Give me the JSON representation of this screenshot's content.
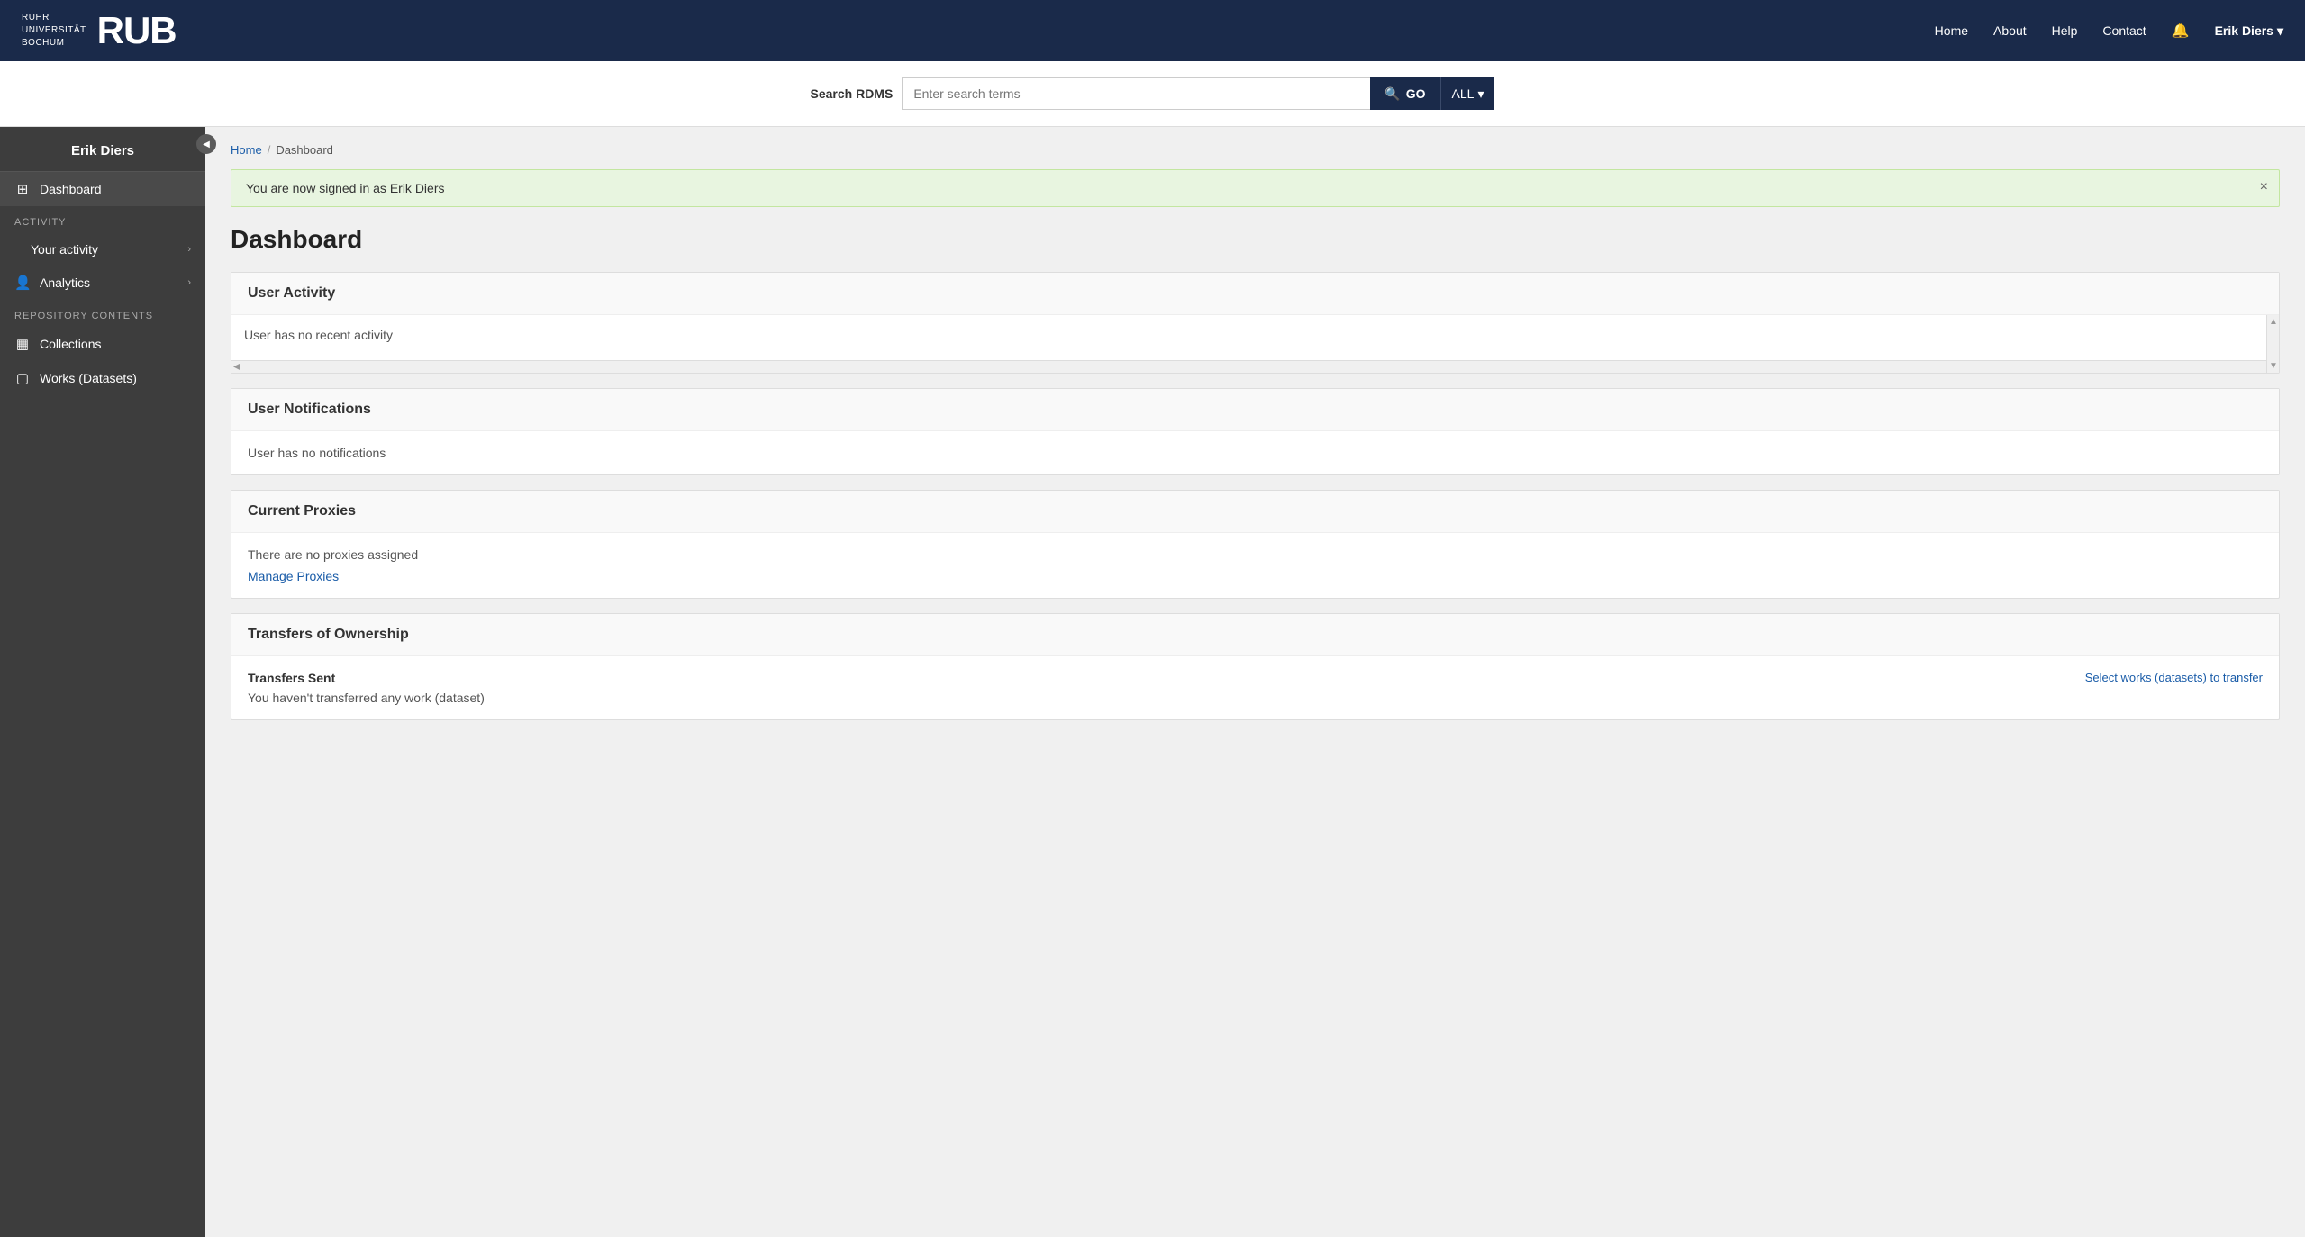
{
  "topnav": {
    "university_line1": "RUHR",
    "university_line2": "UNIVERSITÄT",
    "university_line3": "BOCHUM",
    "logo": "RUB",
    "links": [
      {
        "label": "Home",
        "id": "home"
      },
      {
        "label": "About",
        "id": "about"
      },
      {
        "label": "Help",
        "id": "help"
      },
      {
        "label": "Contact",
        "id": "contact"
      }
    ],
    "user": "Erik Diers"
  },
  "search": {
    "label": "Search RDMS",
    "placeholder": "Enter search terms",
    "go_label": "GO",
    "all_label": "ALL"
  },
  "sidebar": {
    "user_name": "Erik Diers",
    "dashboard_label": "Dashboard",
    "activity_section_label": "ACTIVITY",
    "your_activity_label": "Your activity",
    "analytics_label": "Analytics",
    "repo_section_label": "REPOSITORY CONTENTS",
    "collections_label": "Collections",
    "works_label": "Works (Datasets)"
  },
  "breadcrumb": {
    "home_label": "Home",
    "current": "Dashboard"
  },
  "alert": {
    "message": "You are now signed in as Erik Diers"
  },
  "page_title": "Dashboard",
  "sections": {
    "user_activity": {
      "title": "User Activity",
      "empty_message": "User has no recent activity"
    },
    "user_notifications": {
      "title": "User Notifications",
      "empty_message": "User has no notifications"
    },
    "current_proxies": {
      "title": "Current Proxies",
      "empty_message": "There are no proxies assigned",
      "manage_link": "Manage Proxies"
    },
    "transfers_ownership": {
      "title": "Transfers of Ownership",
      "transfers_sent_label": "Transfers Sent",
      "transfers_sent_message": "You haven't transferred any work (dataset)",
      "select_link": "Select works (datasets) to transfer"
    }
  }
}
